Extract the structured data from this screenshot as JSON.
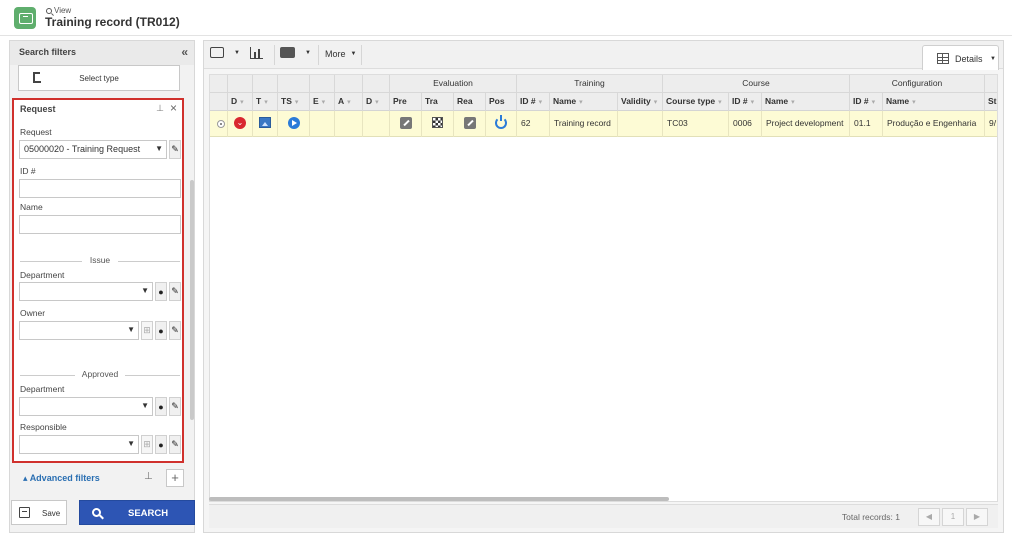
{
  "header": {
    "breadcrumb": "View",
    "title": "Training record (TR012)"
  },
  "filters": {
    "title": "Search filters",
    "collapse_icon": "double-chevron-left-icon",
    "select_type_label": "Select type",
    "request_section": {
      "title": "Request",
      "request_label": "Request",
      "request_value": "05000020 - Training Request",
      "id_label": "ID #",
      "id_value": "",
      "name_label": "Name",
      "name_value": "",
      "issue_heading": "Issue",
      "issue_department_label": "Department",
      "issue_owner_label": "Owner",
      "approved_heading": "Approved",
      "approved_department_label": "Department",
      "approved_responsible_label": "Responsible"
    },
    "advanced_filters_label": "Advanced filters",
    "save_label": "Save",
    "search_label": "SEARCH"
  },
  "toolbar": {
    "more_label": "More",
    "details_label": "Details"
  },
  "grid": {
    "group_headers": [
      "Evaluation",
      "Training",
      "Course",
      "Configuration"
    ],
    "columns": [
      "D",
      "T",
      "TS",
      "E",
      "A",
      "D",
      "Pre",
      "Tra",
      "Rea",
      "Pos",
      "ID #",
      "Name",
      "Validity",
      "Course type",
      "ID #",
      "Name",
      "ID #",
      "Name",
      "St"
    ],
    "row": {
      "training_id": "62",
      "training_name": "Training record",
      "validity": "",
      "course_type": "TC03",
      "course_id": "0006",
      "course_name": "Project development",
      "config_id": "01.1",
      "config_name": "Produção e Engenharia",
      "status": "9/"
    }
  },
  "footer": {
    "total_records": "Total records: 1",
    "page": "1"
  },
  "colors": {
    "accent": "#2d55b4",
    "highlight_border": "#d0312d",
    "selected_row": "#fdfbd5",
    "app_icon": "#5fae6d"
  }
}
